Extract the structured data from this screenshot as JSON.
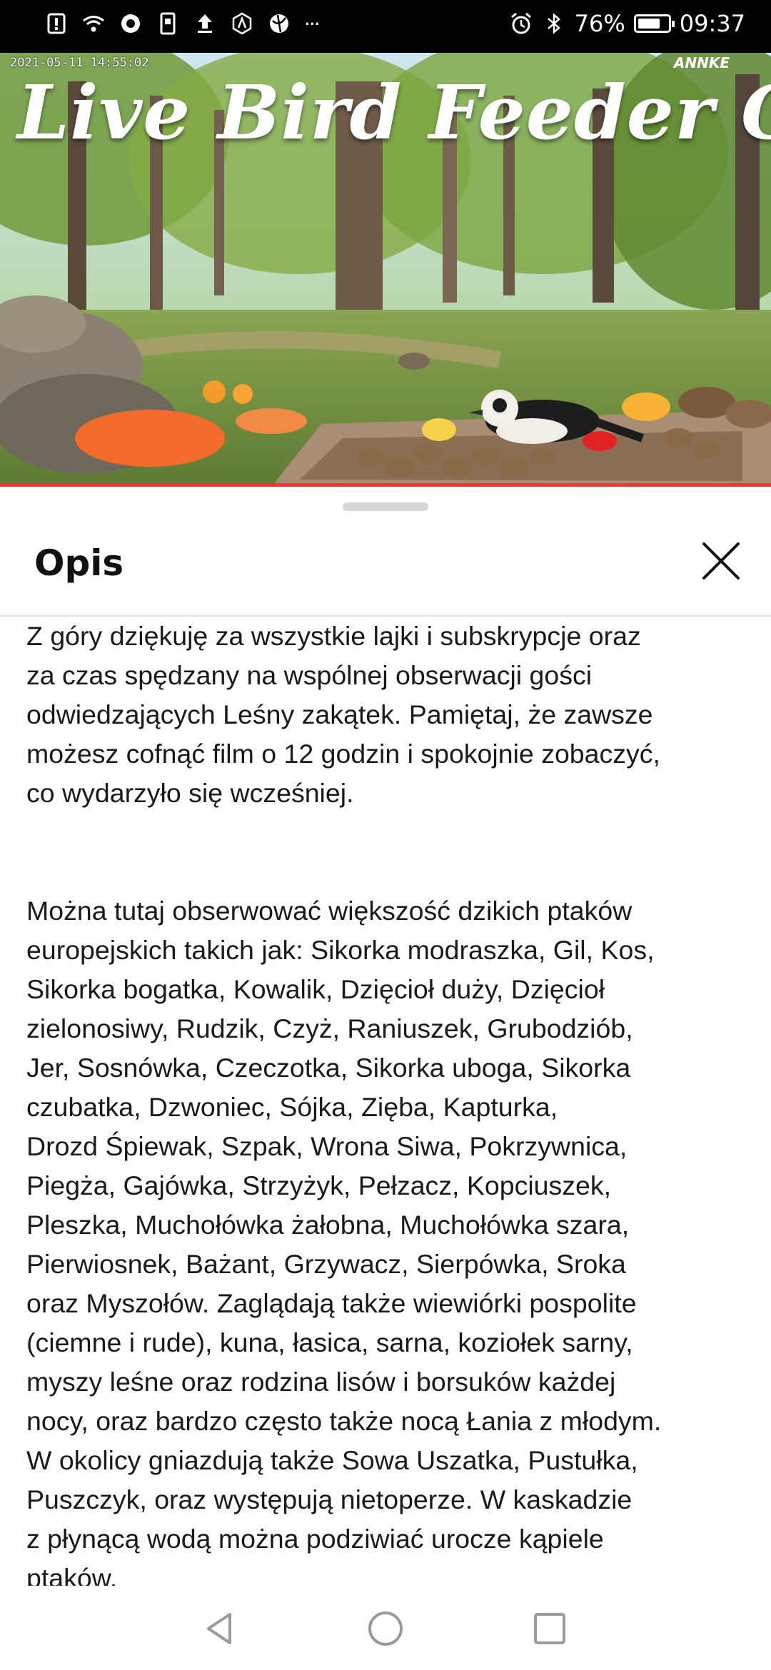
{
  "status_bar": {
    "time": "09:37",
    "battery": "76%",
    "battery_level": 0.76,
    "left_icons": [
      "download-notice-icon",
      "wifi-icon",
      "app-icon",
      "sim-icon",
      "upload-icon",
      "nfc-icon",
      "globe-icon",
      "more-dots-icon"
    ],
    "right_icons": [
      "alarm-icon",
      "bluetooth-icon",
      "battery-icon"
    ],
    "more_label": "···"
  },
  "video": {
    "title": "Live Bird Feeder Cam",
    "timestamp": "2021-05-11 14:55:02",
    "brand": "ANNKE",
    "progress": 1.0,
    "progress_color": "#e53935"
  },
  "sheet": {
    "title": "Opis",
    "close_icon": "close-icon",
    "paragraphs": [
      "Z góry dziękuję za wszystkie lajki i subskrypcje oraz\nza czas spędzany na wspólnej obserwacji gości\nodwiedzających Leśny zakątek. Pamiętaj, że zawsze\nmożesz cofnąć film o 12 godzin i spokojnie zobaczyć,\nco wydarzyło się wcześniej.",
      "Można tutaj obserwować większość dzikich ptaków\neuropejskich takich jak: Sikorka modraszka, Gil, Kos,\nSikorka bogatka, Kowalik, Dzięcioł duży, Dzięcioł\nzielonosiwy, Rudzik, Czyż, Raniuszek, Grubodziób,\nJer, Sosnówka, Czeczotka, Sikorka uboga, Sikorka\nczubatka, Dzwoniec, Sójka, Zięba, Kapturka,\nDrozd Śpiewak, Szpak, Wrona Siwa, Pokrzywnica,\nPiegża, Gajówka, Strzyżyk, Pełzacz, Kopciuszek,\nPleszka, Muchołówka żałobna, Muchołówka szara,\nPierwiosnek, Bażant, Grzywacz, Sierpówka, Sroka\noraz Myszołów. Zaglądają także wiewiórki pospolite\n(ciemne i rude), kuna, łasica, sarna, koziołek sarny,\nmyszy leśne oraz rodzina lisów i borsuków każdej\nnocy, oraz bardzo często także nocą Łania z młodym.\nW okolicy gniazdują także Sowa Uszatka, Pustułka,\nPuszczyk, oraz występują nietoperze. W kaskadzie\nz płynącą wodą można podziwiać urocze kąpiele\nptaków."
    ]
  },
  "nav": {
    "buttons": [
      "back-icon",
      "home-icon",
      "recents-icon"
    ]
  }
}
